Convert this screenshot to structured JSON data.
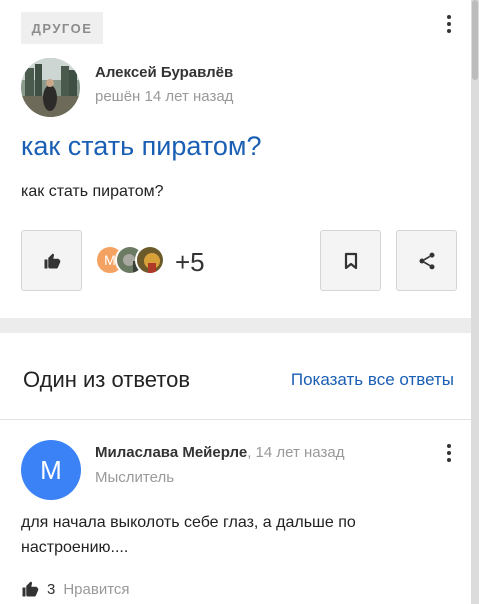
{
  "question": {
    "category": "ДРУГОЕ",
    "author": "Алексей Буравлёв",
    "time": "решён 14 лет назад",
    "title": "как стать пиратом?",
    "body": "как стать пиратом?",
    "likes_extra": "+5",
    "like_avatars": [
      {
        "letter": "М",
        "color": "#f4a261"
      },
      {
        "letter": "",
        "color": "#6b7a63"
      },
      {
        "letter": "",
        "color": "#b98a2a"
      }
    ]
  },
  "answers": {
    "heading": "Один из ответов",
    "show_all": "Показать все ответы",
    "answer": {
      "avatar_letter": "М",
      "author": "Миласлава Мейерле",
      "time": ", 14 лет назад",
      "rank": "Мыслитель",
      "text": "для начала выколоть себе глаз, а дальше по настроению....",
      "like_count": "3",
      "like_label": "Нравится"
    }
  },
  "colors": {
    "link": "#1a5fb4",
    "avatar_blue": "#3b82f6"
  }
}
